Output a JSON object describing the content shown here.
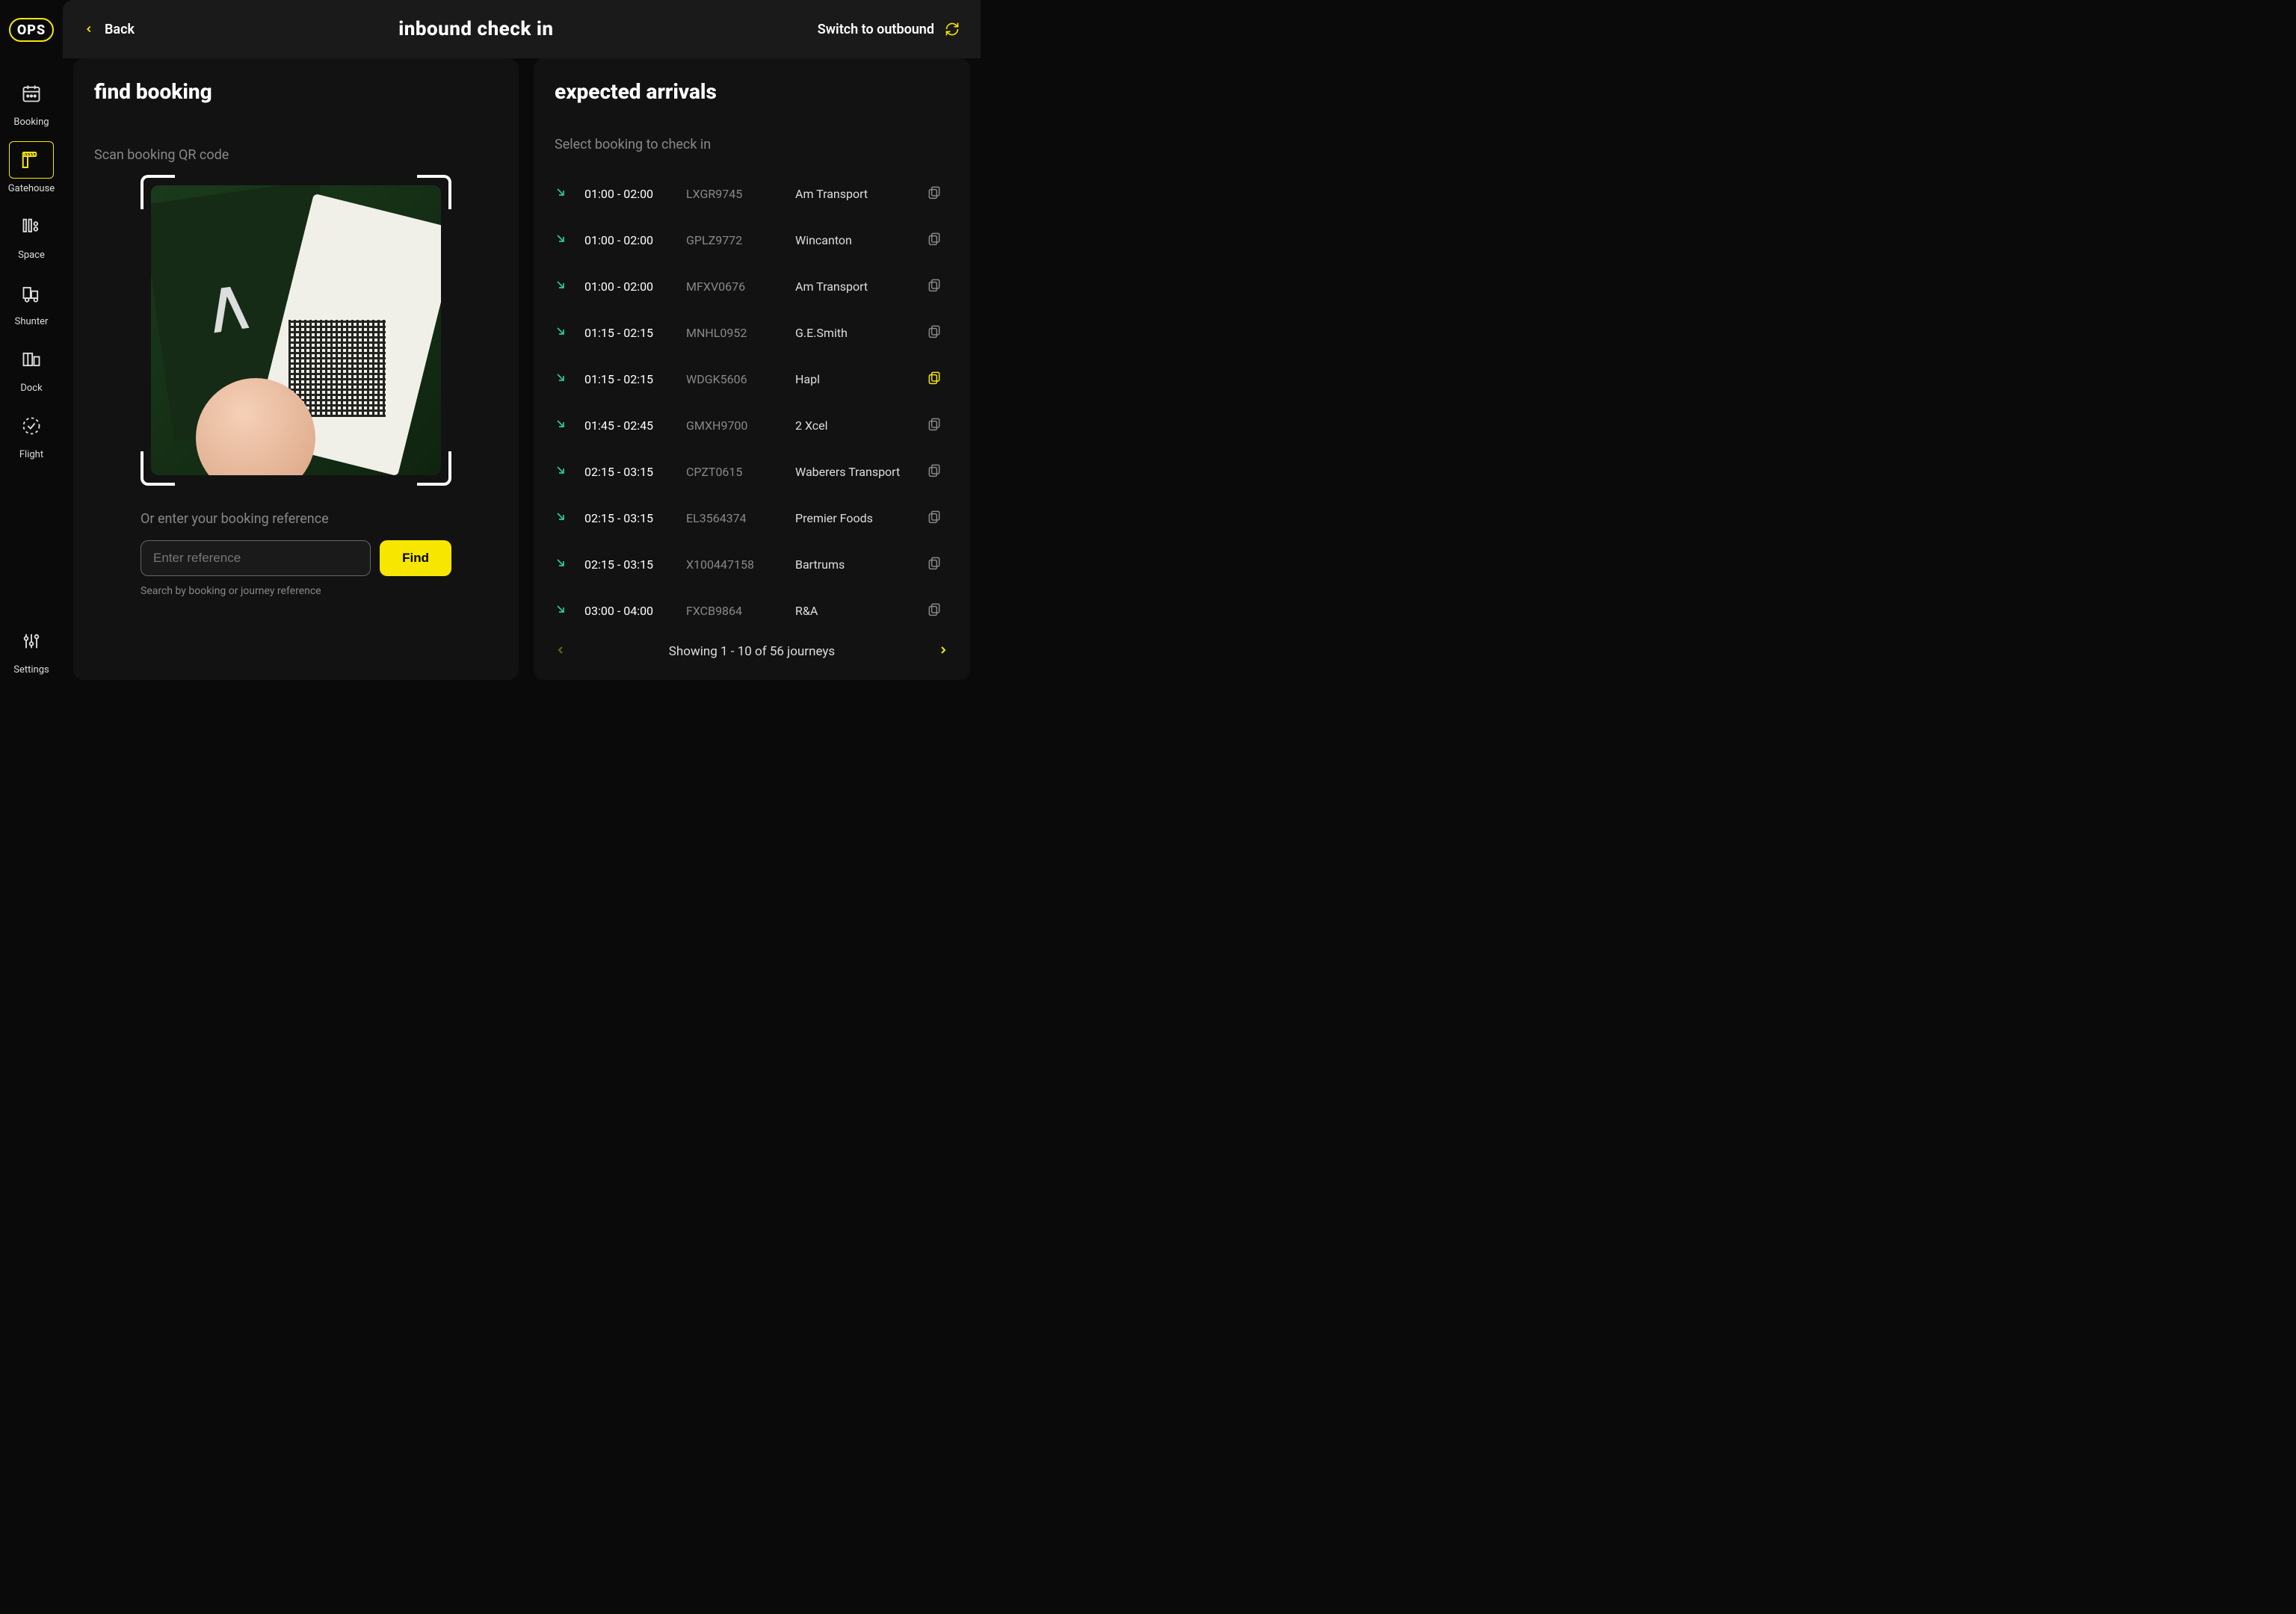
{
  "brand": "OPS",
  "sidebar": {
    "items": [
      {
        "label": "Booking",
        "icon": "calendar-icon",
        "active": false
      },
      {
        "label": "Gatehouse",
        "icon": "gate-icon",
        "active": true
      },
      {
        "label": "Space",
        "icon": "space-icon",
        "active": false
      },
      {
        "label": "Shunter",
        "icon": "shunter-icon",
        "active": false
      },
      {
        "label": "Dock",
        "icon": "dock-icon",
        "active": false
      },
      {
        "label": "Flight",
        "icon": "flight-icon",
        "active": false
      }
    ],
    "settings_label": "Settings"
  },
  "header": {
    "back_label": "Back",
    "title": "inbound check in",
    "switch_label": "Switch to outbound"
  },
  "left": {
    "heading": "find booking",
    "scan_label": "Scan booking QR code",
    "ref_label": "Or enter your booking reference",
    "ref_placeholder": "Enter reference",
    "find_label": "Find",
    "ref_hint": "Search by booking or journey reference"
  },
  "right": {
    "heading": "expected arrivals",
    "sub": "Select booking to check in",
    "arrivals": [
      {
        "time": "01:00 - 02:00",
        "ref": "LXGR9745",
        "company": "Am Transport",
        "highlighted": false
      },
      {
        "time": "01:00 - 02:00",
        "ref": "GPLZ9772",
        "company": "Wincanton",
        "highlighted": false
      },
      {
        "time": "01:00 - 02:00",
        "ref": "MFXV0676",
        "company": "Am Transport",
        "highlighted": false
      },
      {
        "time": "01:15 - 02:15",
        "ref": "MNHL0952",
        "company": "G.E.Smith",
        "highlighted": false
      },
      {
        "time": "01:15 - 02:15",
        "ref": "WDGK5606",
        "company": "Hapl",
        "highlighted": true
      },
      {
        "time": "01:45 - 02:45",
        "ref": "GMXH9700",
        "company": "2 Xcel",
        "highlighted": false
      },
      {
        "time": "02:15 - 03:15",
        "ref": "CPZT0615",
        "company": "Waberers Transport",
        "highlighted": false
      },
      {
        "time": "02:15 - 03:15",
        "ref": "EL3564374",
        "company": "Premier Foods",
        "highlighted": false
      },
      {
        "time": "02:15 - 03:15",
        "ref": "X100447158",
        "company": "Bartrums",
        "highlighted": false
      },
      {
        "time": "03:00 - 04:00",
        "ref": "FXCB9864",
        "company": "R&A",
        "highlighted": false
      }
    ],
    "pager_text": "Showing 1 - 10 of 56 journeys"
  },
  "colors": {
    "accent": "#f7e600",
    "teal": "#2fc8a0"
  }
}
